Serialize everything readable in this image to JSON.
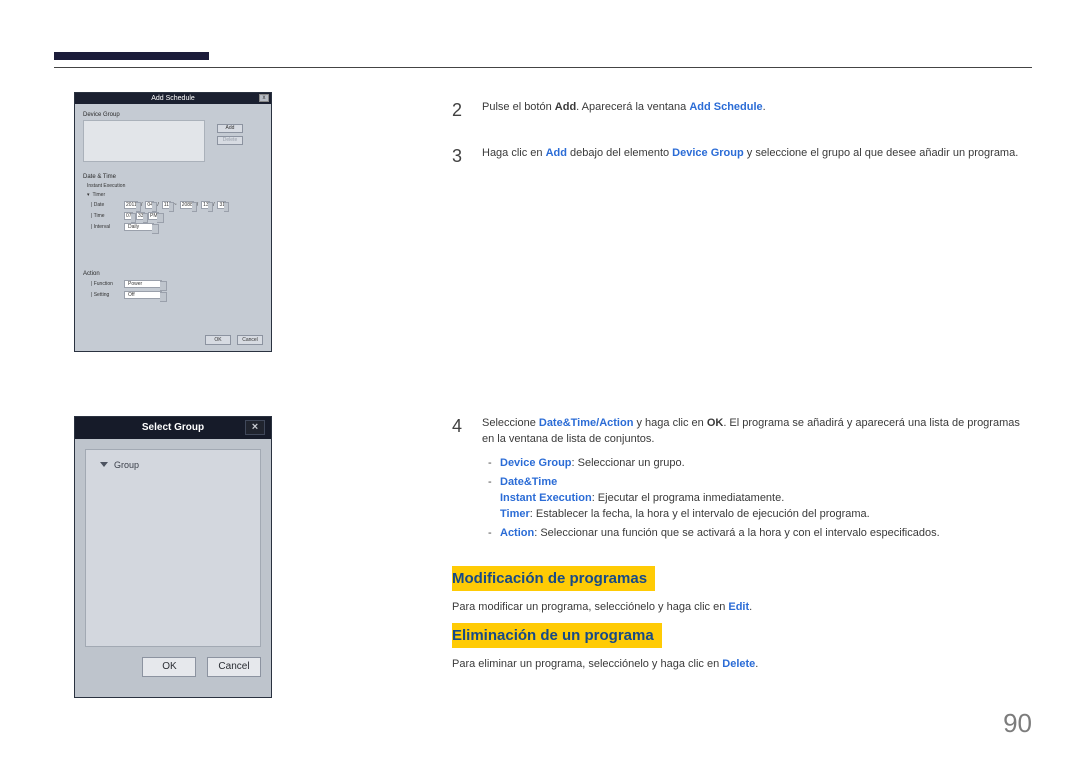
{
  "page_number": "90",
  "dialog1": {
    "title": "Add Schedule",
    "close": "x",
    "device_group_label": "Device Group",
    "add_btn": "Add",
    "delete_btn": "Delete",
    "date_time_label": "Date & Time",
    "instant_exec": "Instant Execution",
    "timer_label": "Timer",
    "date_label": "Date",
    "date_y1": "2011",
    "date_m1": "04",
    "date_d1": "11",
    "tilde": "~",
    "date_y2": "2088",
    "date_m2": "13",
    "date_d2": "31",
    "time_label": "Time",
    "time_h": "07",
    "time_m": "33",
    "time_ampm": "PM",
    "interval_label": "Interval",
    "interval_val": "Daily",
    "action_label": "Action",
    "function_label": "Function",
    "function_val": "Power",
    "setting_label": "Setting",
    "setting_val": "Off",
    "ok": "OK",
    "cancel": "Cancel"
  },
  "dialog2": {
    "title": "Select Group",
    "close": "×",
    "group": "Group",
    "ok": "OK",
    "cancel": "Cancel"
  },
  "steps": {
    "n2": "2",
    "n3": "3",
    "n4": "4",
    "s2_pre": "Pulse el botón ",
    "s2_add": "Add",
    "s2_mid": ". Aparecerá la ventana ",
    "s2_addsched": "Add Schedule",
    "s2_end": ".",
    "s3_pre": "Haga clic en ",
    "s3_add": "Add",
    "s3_mid": " debajo del elemento ",
    "s3_dg": "Device Group",
    "s3_end": " y seleccione el grupo al que desee añadir un programa.",
    "s4_pre": "Seleccione ",
    "s4_dt": "Date&Time",
    "s4_slash": "/",
    "s4_action": "Action",
    "s4_mid": " y haga clic en ",
    "s4_ok": "OK",
    "s4_end": ". El programa se añadirá y aparecerá una lista de programas en la ventana de lista de conjuntos.",
    "li1_b": "Device Group",
    "li1_t": ": Seleccionar un grupo.",
    "li2_b": "Date&Time",
    "li2b_b": "Instant Execution",
    "li2b_t": ": Ejecutar el programa inmediatamente.",
    "li2c_b": "Timer",
    "li2c_t": ": Establecer la fecha, la hora y el intervalo de ejecución del programa.",
    "li3_b": "Action",
    "li3_t": ": Seleccionar una función que se activará a la hora y con el intervalo especificados."
  },
  "sec2": {
    "h": "Modificación de programas",
    "p_pre": "Para modificar un programa, selecciónelo y haga clic en ",
    "p_edit": "Edit",
    "p_end": "."
  },
  "sec3": {
    "h": "Eliminación de un programa",
    "p_pre": "Para eliminar un programa, selecciónelo y haga clic en ",
    "p_del": "Delete",
    "p_end": "."
  }
}
